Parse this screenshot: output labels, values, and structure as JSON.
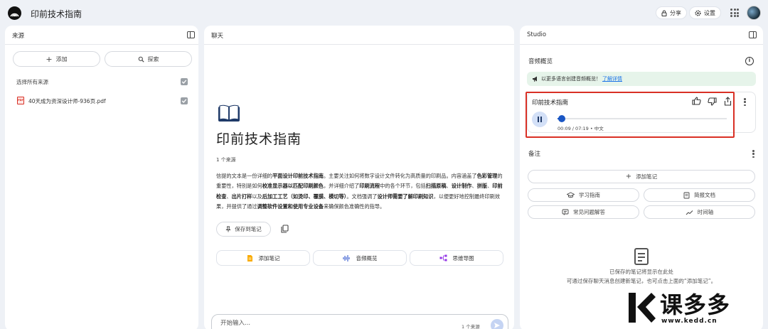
{
  "app": {
    "title": "印前技术指南",
    "share_label": "分享",
    "settings_label": "设置",
    "logo_icon": "notebook-logo-icon",
    "apps_icon": "apps-grid-icon"
  },
  "sources": {
    "title": "来源",
    "add_label": "添加",
    "discover_label": "探索",
    "select_all_label": "选择所有来源",
    "items": [
      {
        "name": "40天成为资深设计师-936页.pdf",
        "checked": true
      }
    ]
  },
  "chat": {
    "title": "聊天",
    "notebook_title": "印前技术指南",
    "source_count": "1 个来源",
    "summary_parts": [
      {
        "text": "信提的文本是一份详细的",
        "bold": false
      },
      {
        "text": "平面设计印前技术指南",
        "bold": true
      },
      {
        "text": "。主要关注如何将数字设计文件转化为高质量的印刷品。内容涵盖了",
        "bold": false
      },
      {
        "text": "色彩管理",
        "bold": true
      },
      {
        "text": "的重要性，特别是如何",
        "bold": false
      },
      {
        "text": "校准显示器以匹配印刷颜色",
        "bold": true
      },
      {
        "text": "，并详细介绍了",
        "bold": false
      },
      {
        "text": "印刷流程",
        "bold": true
      },
      {
        "text": "中的各个环节，包括",
        "bold": false
      },
      {
        "text": "扫描原稿",
        "bold": true
      },
      {
        "text": "、",
        "bold": false
      },
      {
        "text": "设计制作",
        "bold": true
      },
      {
        "text": "、",
        "bold": false
      },
      {
        "text": "拼版",
        "bold": true
      },
      {
        "text": "、",
        "bold": false
      },
      {
        "text": "印前检查",
        "bold": true
      },
      {
        "text": "、",
        "bold": false
      },
      {
        "text": "出片打样",
        "bold": true
      },
      {
        "text": "以及",
        "bold": false
      },
      {
        "text": "后加工工艺（如烫印、覆膜、模切等）",
        "bold": true
      },
      {
        "text": "。文档强调了",
        "bold": false
      },
      {
        "text": "设计师需要了解印刷知识",
        "bold": true
      },
      {
        "text": "，以便更好地控制最终印刷效果，并提供了通过",
        "bold": false
      },
      {
        "text": "调整软件设置和使用专业设备",
        "bold": true
      },
      {
        "text": "来确保颜色准确性的指导。",
        "bold": false
      }
    ],
    "save_to_note_label": "保存到笔记",
    "actions": [
      {
        "label": "添加笔记",
        "icon": "note-icon"
      },
      {
        "label": "音频概览",
        "icon": "waveform-icon"
      },
      {
        "label": "思维导图",
        "icon": "mindmap-icon"
      }
    ],
    "input_placeholder": "开始输入...",
    "input_source_count": "1 个来源"
  },
  "studio": {
    "title": "Studio",
    "audio_overview_label": "音频概览",
    "banner_text": "以更多语言创建音频概览！",
    "banner_link": "了解详情",
    "audio_card": {
      "title": "印前技术指南",
      "time_text": "00:09 / 07:19 • 中文",
      "progress": 0.02
    },
    "notes_label": "备注",
    "add_note_label": "添加笔记",
    "note_buttons": [
      {
        "label": "学习指南",
        "icon": "graduation-cap-icon"
      },
      {
        "label": "简报文档",
        "icon": "document-icon"
      },
      {
        "label": "常见问题解答",
        "icon": "faq-icon"
      },
      {
        "label": "时间轴",
        "icon": "timeline-icon"
      }
    ],
    "empty_line1": "已保存的笔记将显示在此处",
    "empty_line2": "可通过保存聊天消息创建新笔记，也可点击上面的“添加笔记”。"
  },
  "watermark": {
    "brand": "课多多",
    "url": "www.kedd.cn"
  },
  "colors": {
    "accent": "#1a56c4",
    "highlight": "#d93025",
    "banner_bg": "#e6f4ea",
    "page_bg": "#eef1f6"
  }
}
